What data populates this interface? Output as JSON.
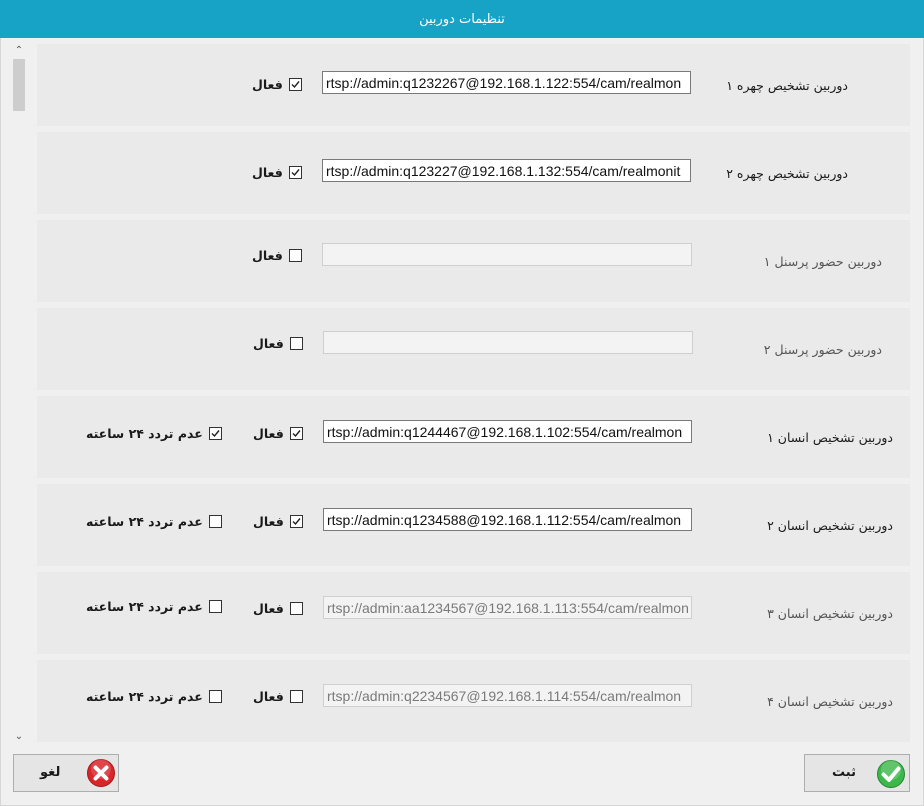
{
  "window": {
    "title": "تنظیمات دوربین"
  },
  "common": {
    "active_label": "فعال",
    "no_traffic_label": "عدم تردد ۲۴ ساعته"
  },
  "cameras": [
    {
      "label": "دوربین تشخیص چهره ۱",
      "url": "rtsp://admin:q1232267@192.168.1.122:554/cam/realmon",
      "active": true
    },
    {
      "label": "دوربین تشخیص چهره ۲",
      "url": "rtsp://admin:q123227@192.168.1.132:554/cam/realmonit",
      "active": true
    },
    {
      "label": "دوربین حضور پرسنل ۱",
      "url": "",
      "active": false
    },
    {
      "label": "دوربین حضور پرسنل ۲",
      "url": "",
      "active": false
    },
    {
      "label": "دوربین تشخیص انسان ۱",
      "url": "rtsp://admin:q1244467@192.168.1.102:554/cam/realmon",
      "active": true,
      "no_traffic": true
    },
    {
      "label": "دوربین تشخیص انسان ۲",
      "url": "rtsp://admin:q1234588@192.168.1.112:554/cam/realmon",
      "active": true,
      "no_traffic": false
    },
    {
      "label": "دوربین تشخیص انسان ۳",
      "url": "rtsp://admin:aa1234567@192.168.1.113:554/cam/realmon",
      "active": false,
      "no_traffic": false
    },
    {
      "label": "دوربین تشخیص انسان ۴",
      "url": "rtsp://admin:q2234567@192.168.1.114:554/cam/realmon",
      "active": false,
      "no_traffic": false
    }
  ],
  "buttons": {
    "save_label": "ثبت",
    "cancel_label": "لغو"
  },
  "colors": {
    "titlebar": "#17a3c6",
    "save_icon": "#3cb84a",
    "cancel_icon": "#d9262b"
  }
}
